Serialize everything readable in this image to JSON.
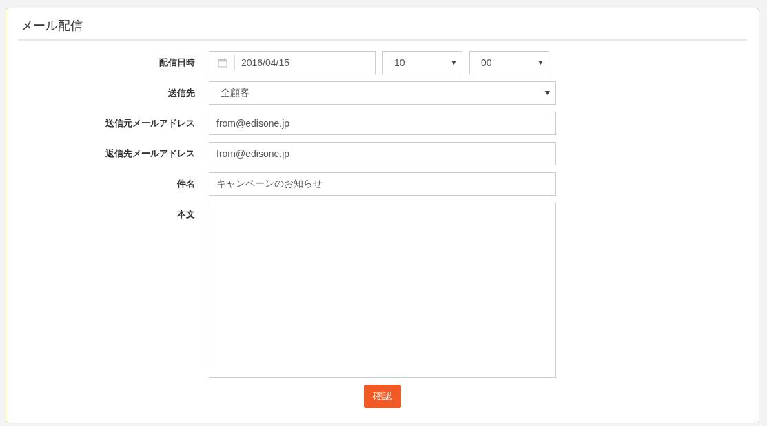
{
  "panel": {
    "title": "メール配信"
  },
  "fields": [
    {
      "kind": "datetime",
      "label": "配信日時",
      "date": "2016/04/15",
      "hour": "10",
      "minute": "00"
    },
    {
      "kind": "select",
      "label": "送信先",
      "value": "全顧客"
    },
    {
      "kind": "text",
      "label": "送信元メールアドレス",
      "value": "from@edisone.jp"
    },
    {
      "kind": "text",
      "label": "返信先メールアドレス",
      "value": "from@edisone.jp"
    },
    {
      "kind": "text",
      "label": "件名",
      "value": "キャンペーンのお知らせ"
    },
    {
      "kind": "textarea",
      "label": "本文"
    }
  ],
  "submit": {
    "label": "確認"
  }
}
